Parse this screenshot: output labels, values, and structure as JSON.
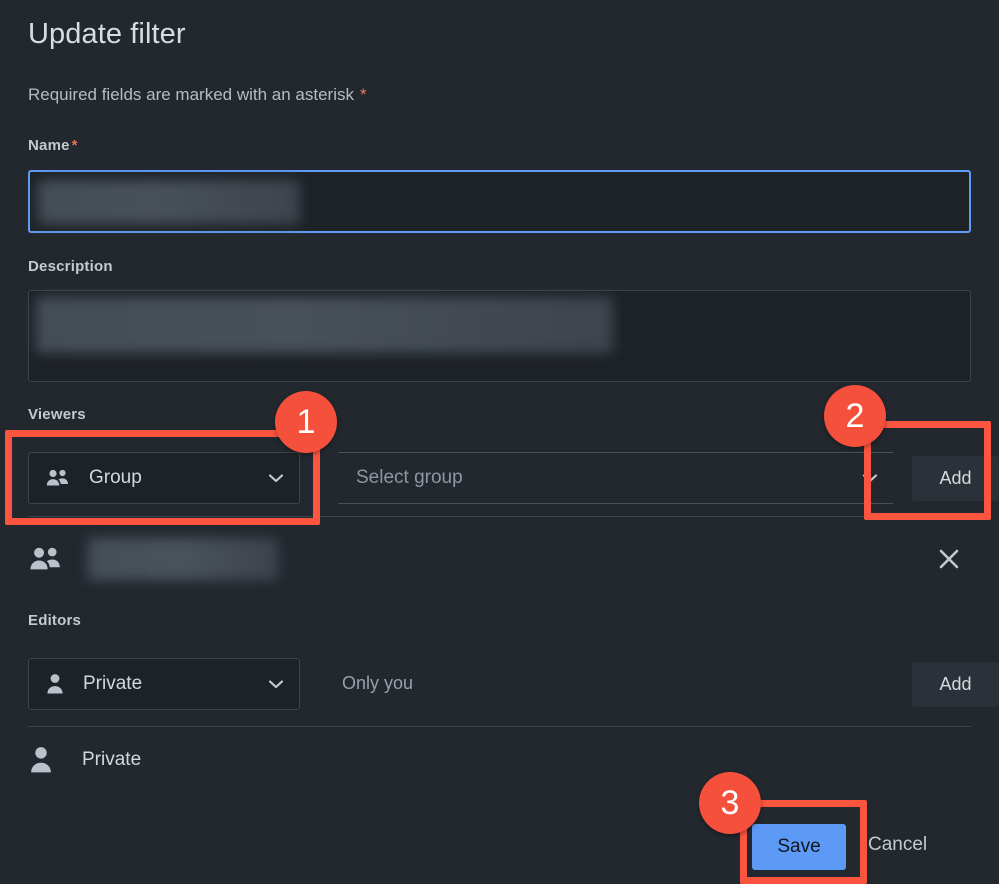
{
  "dialog": {
    "title": "Update filter",
    "required_note": "Required fields are marked with an asterisk",
    "required_marker": "*"
  },
  "fields": {
    "name": {
      "label": "Name",
      "required_marker": "*",
      "value": "",
      "redacted": true,
      "focused": true
    },
    "description": {
      "label": "Description",
      "value": "",
      "redacted": true
    }
  },
  "viewers": {
    "label": "Viewers",
    "type_select": {
      "value": "Group",
      "icon": "group-icon",
      "chevron": "chevron-down-icon"
    },
    "group_select": {
      "placeholder": "Select group",
      "value": "",
      "chevron": "chevron-down-icon"
    },
    "add_label": "Add",
    "entries": [
      {
        "icon": "group-icon",
        "name": "",
        "redacted": true,
        "remove_icon": "close-icon"
      }
    ]
  },
  "editors": {
    "label": "Editors",
    "type_select": {
      "value": "Private",
      "icon": "user-icon",
      "chevron": "chevron-down-icon"
    },
    "hint": "Only you",
    "add_label": "Add",
    "entries": [
      {
        "icon": "user-icon",
        "name": "Private"
      }
    ]
  },
  "footer": {
    "save_label": "Save",
    "cancel_label": "Cancel"
  },
  "annotations": [
    {
      "number": "1",
      "target": "viewers-type-select"
    },
    {
      "number": "2",
      "target": "viewers-add-button"
    },
    {
      "number": "3",
      "target": "save-button"
    }
  ],
  "colors": {
    "background": "#22282e",
    "input_background": "#1d2227",
    "focus_border": "#5f9cf5",
    "primary_button": "#5c9af5",
    "annotation": "#f4503b",
    "text": "#d2d8de",
    "muted_text": "#8e97a1",
    "asterisk": "#e8705a"
  }
}
